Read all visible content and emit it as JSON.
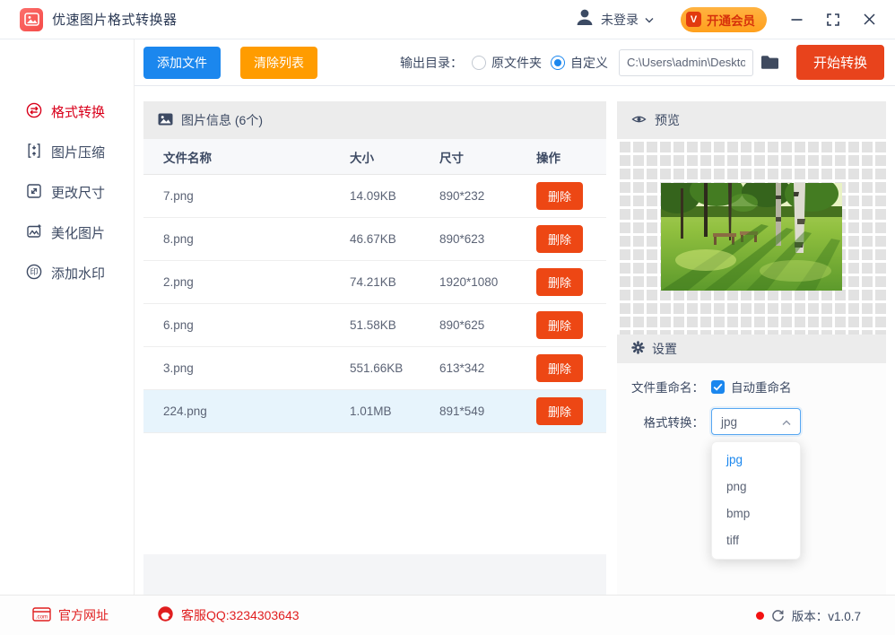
{
  "colors": {
    "accent_blue": "#1B87EE",
    "accent_orange": "#FF9C00",
    "accent_red": "#E8431C",
    "delete_red": "#ED4714",
    "active_item_red": "#D9001B",
    "link_red": "#E01E1F",
    "selected_row_bg": "#E7F4FC"
  },
  "titlebar": {
    "app_title": "优速图片格式转换器",
    "login_label": "未登录",
    "vip_badge": "V",
    "vip_label": "开通会员"
  },
  "toolbar": {
    "add_files_label": "添加文件",
    "clear_list_label": "清除列表",
    "output_dir_label": "输出目录：",
    "radio_original_label": "原文件夹",
    "radio_custom_label": "自定义",
    "output_path_value": "C:\\Users\\admin\\Deskto",
    "start_convert_label": "开始转换"
  },
  "sidebar": {
    "items": [
      {
        "label": "格式转换"
      },
      {
        "label": "图片压缩"
      },
      {
        "label": "更改尺寸"
      },
      {
        "label": "美化图片"
      },
      {
        "label": "添加水印"
      }
    ]
  },
  "file_panel": {
    "title": "图片信息 (6个)",
    "columns": {
      "name": "文件名称",
      "size": "大小",
      "dims": "尺寸",
      "ops": "操作"
    },
    "delete_label": "删除",
    "rows": [
      {
        "name": "7.png",
        "size": "14.09KB",
        "dims": "890*232"
      },
      {
        "name": "8.png",
        "size": "46.67KB",
        "dims": "890*623"
      },
      {
        "name": "2.png",
        "size": "74.21KB",
        "dims": "1920*1080"
      },
      {
        "name": "6.png",
        "size": "51.58KB",
        "dims": "890*625"
      },
      {
        "name": "3.png",
        "size": "551.66KB",
        "dims": "613*342"
      },
      {
        "name": "224.png",
        "size": "1.01MB",
        "dims": "891*549"
      }
    ]
  },
  "preview": {
    "title": "预览"
  },
  "settings": {
    "title": "设置",
    "rename_label": "文件重命名：",
    "rename_checkbox_label": "自动重命名",
    "format_label": "格式转换：",
    "format_value": "jpg",
    "format_options": [
      "jpg",
      "png",
      "bmp",
      "tiff"
    ]
  },
  "footer": {
    "website_label": "官方网址",
    "qq_label": "客服QQ:3234303643",
    "version_label": "版本：v1.0.7"
  }
}
